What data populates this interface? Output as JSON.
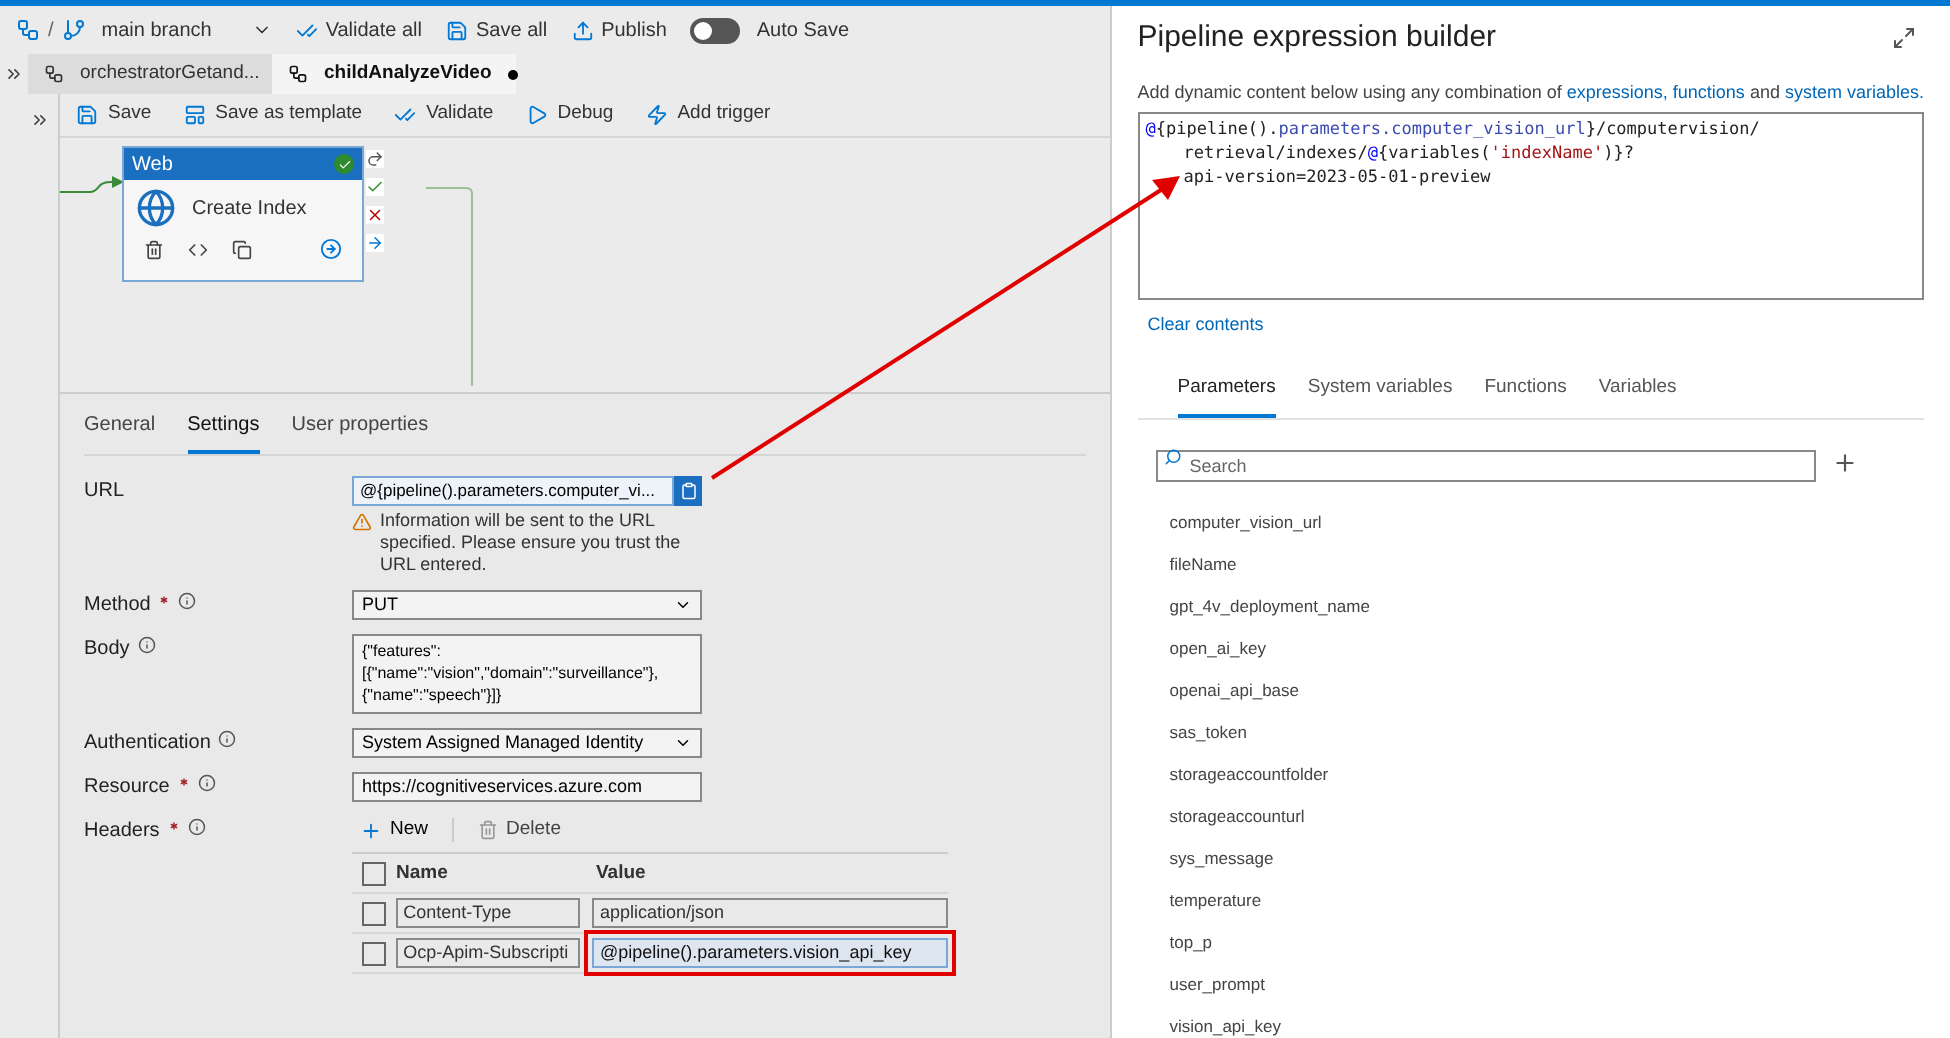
{
  "toolbar": {
    "separator": "/",
    "branch": "main branch",
    "actions": [
      {
        "kind": "validate",
        "label": "Validate all"
      },
      {
        "kind": "save",
        "label": "Save all"
      },
      {
        "kind": "publish",
        "label": "Publish"
      }
    ],
    "auto_save": {
      "label": "Auto Save",
      "on": false
    }
  },
  "doc_tabs": [
    {
      "label": "orchestratorGetand...",
      "selected": false,
      "unsaved": false
    },
    {
      "label": "childAnalyzeVideo",
      "selected": true,
      "unsaved": true
    }
  ],
  "pipeline_toolbar": [
    {
      "kind": "save",
      "label": "Save"
    },
    {
      "kind": "template",
      "label": "Save as template"
    },
    {
      "kind": "validate",
      "label": "Validate"
    },
    {
      "kind": "debug",
      "label": "Debug"
    },
    {
      "kind": "trigger",
      "label": "Add trigger"
    }
  ],
  "activity": {
    "type": "Web",
    "name": "Create Index",
    "valid": true
  },
  "props_tabs": [
    {
      "label": "General",
      "selected": false
    },
    {
      "label": "Settings",
      "selected": true
    },
    {
      "label": "User properties",
      "selected": false
    }
  ],
  "settings": {
    "url": {
      "label": "URL",
      "required": false,
      "info": false,
      "value": "@{pipeline().parameters.computer_vi...",
      "warning": "Information will be sent to the URL specified. Please ensure you trust the URL entered."
    },
    "fields": [
      {
        "kind": "select",
        "label": "Method",
        "required": true,
        "info": true,
        "value": "PUT"
      },
      {
        "kind": "textarea",
        "label": "Body",
        "required": false,
        "info": true,
        "value": "{\"features\":\n[{\"name\":\"vision\",\"domain\":\"surveillance\"},\n{\"name\":\"speech\"}]}"
      },
      {
        "kind": "select",
        "label": "Authentication",
        "required": false,
        "info": true,
        "value": "System Assigned Managed Identity"
      },
      {
        "kind": "text",
        "label": "Resource",
        "required": true,
        "info": true,
        "value": "https://cognitiveservices.azure.com"
      }
    ],
    "headers": {
      "label": "Headers",
      "required": true,
      "info": true,
      "new": "New",
      "delete": "Delete",
      "all_checked": false,
      "columns": [
        "Name",
        "Value"
      ],
      "rows": [
        {
          "name": "Content-Type",
          "value": "application/json",
          "checked": false,
          "highlighted": false
        },
        {
          "name": "Ocp-Apim-Subscripti",
          "value": "@pipeline().parameters.vision_api_key",
          "checked": false,
          "highlighted": true
        }
      ]
    }
  },
  "builder": {
    "title": "Pipeline expression builder",
    "description": [
      {
        "kind": "text",
        "text": "Add dynamic content below using any combination of "
      },
      {
        "kind": "link",
        "text": "expressions, functions"
      },
      {
        "kind": "text",
        "text": " and "
      },
      {
        "kind": "link",
        "text": "system variables."
      }
    ],
    "expression": [
      [
        {
          "kind": "at",
          "text": "@"
        },
        {
          "kind": "plain",
          "text": "{pipeline()."
        },
        {
          "kind": "prop",
          "text": "parameters.computer_vision_url"
        },
        {
          "kind": "plain",
          "text": "}/computervision/"
        }
      ],
      [
        {
          "kind": "plain",
          "text": "retrieval/indexes/"
        },
        {
          "kind": "at",
          "text": "@"
        },
        {
          "kind": "plain",
          "text": "{variables("
        },
        {
          "kind": "string",
          "text": "'indexName'"
        },
        {
          "kind": "plain",
          "text": ")}?"
        }
      ],
      [
        {
          "kind": "plain",
          "text": "api-version=2023-05-01-preview"
        }
      ]
    ],
    "clear": "Clear contents",
    "tabs": [
      {
        "label": "Parameters",
        "selected": true
      },
      {
        "label": "System variables",
        "selected": false
      },
      {
        "label": "Functions",
        "selected": false
      },
      {
        "label": "Variables",
        "selected": false
      }
    ],
    "search": {
      "placeholder": "Search"
    },
    "parameters": [
      "computer_vision_url",
      "fileName",
      "gpt_4v_deployment_name",
      "open_ai_key",
      "openai_api_base",
      "sas_token",
      "storageaccountfolder",
      "storageaccounturl",
      "sys_message",
      "temperature",
      "top_p",
      "user_prompt",
      "vision_api_key"
    ]
  }
}
